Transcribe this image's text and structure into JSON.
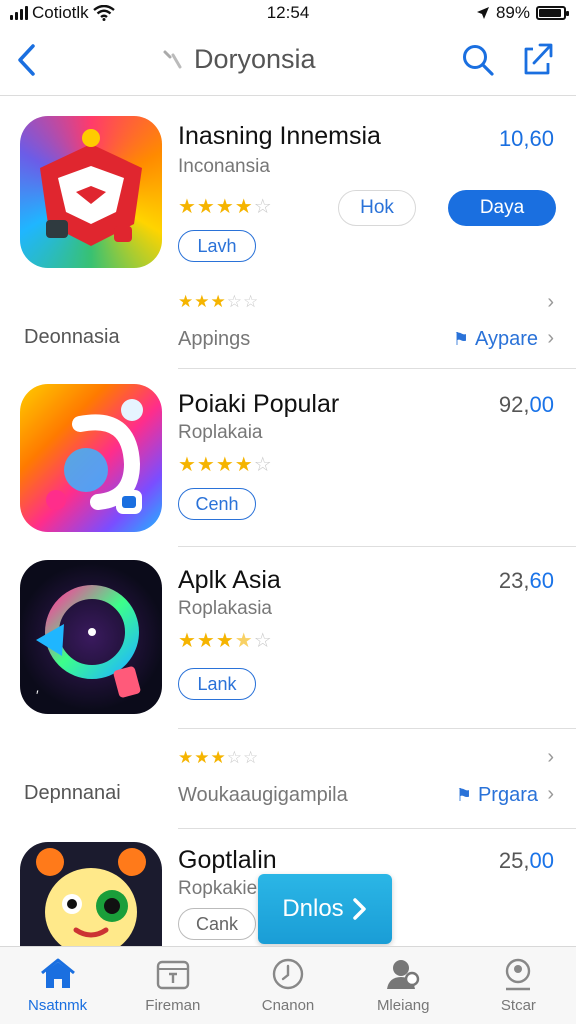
{
  "status": {
    "carrier": "Cotiotlk",
    "time": "12:54",
    "battery": "89%"
  },
  "nav": {
    "title": "Doryonsia"
  },
  "featured": {
    "name": "Inasning Innemsia",
    "subtitle": "Inconansia",
    "price": "10,60",
    "rating": 4,
    "tag": "Lavh",
    "secondary_button": "Hok",
    "primary_button": "Daya"
  },
  "meta_row_1": {
    "left": "Deonnasia",
    "middle": "Appings",
    "link": "Aypare",
    "rating": 3.5
  },
  "apps": [
    {
      "name": "Poiaki Popular",
      "subtitle": "Roplakaia",
      "price_main": "92,",
      "price_accent": "00",
      "rating": 4,
      "tag": "Cenh"
    },
    {
      "name": "Aplk Asia",
      "subtitle": "Roplakasia",
      "price_main": "23,",
      "price_accent": "60",
      "rating": 3.5,
      "tag": "Lank"
    }
  ],
  "meta_row_2": {
    "left": "Depnnanai",
    "middle": "Woukaaugigampila",
    "link": "Prgara",
    "rating": 3.5
  },
  "last_app": {
    "name": "Goptlalin",
    "subtitle": "Ropkakie",
    "price_main": "25,",
    "price_accent": "00",
    "tag": "Cank"
  },
  "floating_button": "Dnlos",
  "tabs": [
    {
      "label": "Nsatnmk",
      "icon": "home-icon",
      "active": true
    },
    {
      "label": "Fireman",
      "icon": "calendar-icon",
      "active": false
    },
    {
      "label": "Cnanon",
      "icon": "clock-icon",
      "active": false
    },
    {
      "label": "Mleiang",
      "icon": "person-icon",
      "active": false
    },
    {
      "label": "Stcar",
      "icon": "profile-icon",
      "active": false
    }
  ],
  "colors": {
    "accent": "#1a6fe0",
    "star": "#f5b400",
    "banner": "#1fa8de"
  }
}
